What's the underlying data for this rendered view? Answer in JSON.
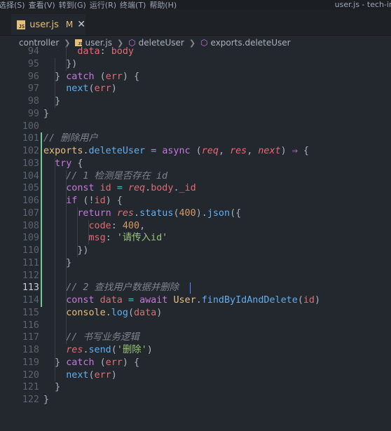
{
  "menubar": {
    "items": [
      "选择(S)",
      "查看(V)",
      "转到(G)",
      "运行(R)",
      "终端(T)",
      "帮助(H)"
    ],
    "title": "user.js - tech-in"
  },
  "tab": {
    "label": "user.js",
    "modified": "M",
    "close": "✕",
    "icon_text": "JS"
  },
  "breadcrumb": [
    "controller",
    "user.js",
    "deleteUser",
    "exports.deleteUser"
  ],
  "editor": {
    "active_line": 113,
    "lines": [
      {
        "n": 94,
        "tokens": [
          [
            "pl",
            "      "
          ],
          [
            "prop",
            "data"
          ],
          [
            "pl",
            ": "
          ],
          [
            "prop",
            "body"
          ]
        ]
      },
      {
        "n": 95,
        "tokens": [
          [
            "pl",
            "    })"
          ]
        ]
      },
      {
        "n": 96,
        "tokens": [
          [
            "pl",
            "  } "
          ],
          [
            "kw",
            "catch"
          ],
          [
            "pl",
            " ("
          ],
          [
            "prop",
            "err"
          ],
          [
            "pl",
            ") {"
          ]
        ]
      },
      {
        "n": 97,
        "tokens": [
          [
            "pl",
            "    "
          ],
          [
            "fn",
            "next"
          ],
          [
            "pl",
            "("
          ],
          [
            "prop",
            "err"
          ],
          [
            "pl",
            ")"
          ]
        ]
      },
      {
        "n": 98,
        "tokens": [
          [
            "pl",
            "  }"
          ]
        ]
      },
      {
        "n": 99,
        "tokens": [
          [
            "pl",
            "}"
          ]
        ]
      },
      {
        "n": 100,
        "tokens": []
      },
      {
        "n": 101,
        "tokens": [
          [
            "cm",
            "// 删除用户"
          ]
        ]
      },
      {
        "n": 102,
        "tokens": [
          [
            "obj",
            "exports"
          ],
          [
            "pl",
            "."
          ],
          [
            "fn",
            "deleteUser"
          ],
          [
            "pl",
            " "
          ],
          [
            "op",
            "="
          ],
          [
            "pl",
            " "
          ],
          [
            "kw",
            "async"
          ],
          [
            "pl",
            " ("
          ],
          [
            "param",
            "req"
          ],
          [
            "pl",
            ", "
          ],
          [
            "param",
            "res"
          ],
          [
            "pl",
            ", "
          ],
          [
            "param",
            "next"
          ],
          [
            "pl",
            ") "
          ],
          [
            "kw",
            "⇒"
          ],
          [
            "pl",
            " {"
          ]
        ]
      },
      {
        "n": 103,
        "tokens": [
          [
            "pl",
            "  "
          ],
          [
            "kw",
            "try"
          ],
          [
            "pl",
            " {"
          ]
        ]
      },
      {
        "n": 104,
        "tokens": [
          [
            "pl",
            "    "
          ],
          [
            "cm",
            "// 1 检测是否存在 id"
          ]
        ]
      },
      {
        "n": 105,
        "tokens": [
          [
            "pl",
            "    "
          ],
          [
            "kw",
            "const"
          ],
          [
            "pl",
            " "
          ],
          [
            "prop",
            "id"
          ],
          [
            "pl",
            " "
          ],
          [
            "op",
            "="
          ],
          [
            "pl",
            " "
          ],
          [
            "param",
            "req"
          ],
          [
            "pl",
            "."
          ],
          [
            "prop",
            "body"
          ],
          [
            "pl",
            "."
          ],
          [
            "prop",
            "_id"
          ]
        ]
      },
      {
        "n": 106,
        "tokens": [
          [
            "pl",
            "    "
          ],
          [
            "kw",
            "if"
          ],
          [
            "pl",
            " (!"
          ],
          [
            "prop",
            "id"
          ],
          [
            "pl",
            ") {"
          ]
        ]
      },
      {
        "n": 107,
        "tokens": [
          [
            "pl",
            "      "
          ],
          [
            "kw",
            "return"
          ],
          [
            "pl",
            " "
          ],
          [
            "param",
            "res"
          ],
          [
            "pl",
            "."
          ],
          [
            "fn",
            "status"
          ],
          [
            "pl",
            "("
          ],
          [
            "num",
            "400"
          ],
          [
            "pl",
            ")."
          ],
          [
            "fn",
            "json"
          ],
          [
            "pl",
            "({"
          ]
        ]
      },
      {
        "n": 108,
        "tokens": [
          [
            "pl",
            "        "
          ],
          [
            "prop",
            "code"
          ],
          [
            "pl",
            ": "
          ],
          [
            "num",
            "400"
          ],
          [
            "pl",
            ","
          ]
        ]
      },
      {
        "n": 109,
        "tokens": [
          [
            "pl",
            "        "
          ],
          [
            "prop",
            "msg"
          ],
          [
            "pl",
            ": "
          ],
          [
            "str",
            "'请传入id'"
          ]
        ]
      },
      {
        "n": 110,
        "tokens": [
          [
            "pl",
            "      })"
          ]
        ]
      },
      {
        "n": 111,
        "tokens": [
          [
            "pl",
            "    }"
          ]
        ]
      },
      {
        "n": 112,
        "tokens": []
      },
      {
        "n": 113,
        "tokens": [
          [
            "pl",
            "    "
          ],
          [
            "cm",
            "// 2 查找用户数据并删除"
          ]
        ]
      },
      {
        "n": 114,
        "tokens": [
          [
            "pl",
            "    "
          ],
          [
            "kw",
            "const"
          ],
          [
            "pl",
            " "
          ],
          [
            "prop",
            "data"
          ],
          [
            "pl",
            " "
          ],
          [
            "op",
            "="
          ],
          [
            "pl",
            " "
          ],
          [
            "kw",
            "await"
          ],
          [
            "pl",
            " "
          ],
          [
            "obj",
            "User"
          ],
          [
            "pl",
            "."
          ],
          [
            "fn",
            "findByIdAndDelete"
          ],
          [
            "pl",
            "("
          ],
          [
            "prop",
            "id"
          ],
          [
            "pl",
            ")"
          ]
        ]
      },
      {
        "n": 115,
        "tokens": [
          [
            "pl",
            "    "
          ],
          [
            "obj",
            "console"
          ],
          [
            "pl",
            "."
          ],
          [
            "fn",
            "log"
          ],
          [
            "pl",
            "("
          ],
          [
            "prop",
            "data"
          ],
          [
            "pl",
            ")"
          ]
        ]
      },
      {
        "n": 116,
        "tokens": []
      },
      {
        "n": 117,
        "tokens": [
          [
            "pl",
            "    "
          ],
          [
            "cm",
            "// 书写业务逻辑"
          ]
        ]
      },
      {
        "n": 118,
        "tokens": [
          [
            "pl",
            "    "
          ],
          [
            "param",
            "res"
          ],
          [
            "pl",
            "."
          ],
          [
            "fn",
            "send"
          ],
          [
            "pl",
            "("
          ],
          [
            "str",
            "'删除'"
          ],
          [
            "pl",
            ")"
          ]
        ]
      },
      {
        "n": 119,
        "tokens": [
          [
            "pl",
            "  } "
          ],
          [
            "kw",
            "catch"
          ],
          [
            "pl",
            " ("
          ],
          [
            "prop",
            "err"
          ],
          [
            "pl",
            ") {"
          ]
        ]
      },
      {
        "n": 120,
        "tokens": [
          [
            "pl",
            "    "
          ],
          [
            "fn",
            "next"
          ],
          [
            "pl",
            "("
          ],
          [
            "prop",
            "err"
          ],
          [
            "pl",
            ")"
          ]
        ]
      },
      {
        "n": 121,
        "tokens": [
          [
            "pl",
            "  }"
          ]
        ]
      },
      {
        "n": 122,
        "tokens": [
          [
            "pl",
            "}"
          ]
        ]
      }
    ]
  }
}
